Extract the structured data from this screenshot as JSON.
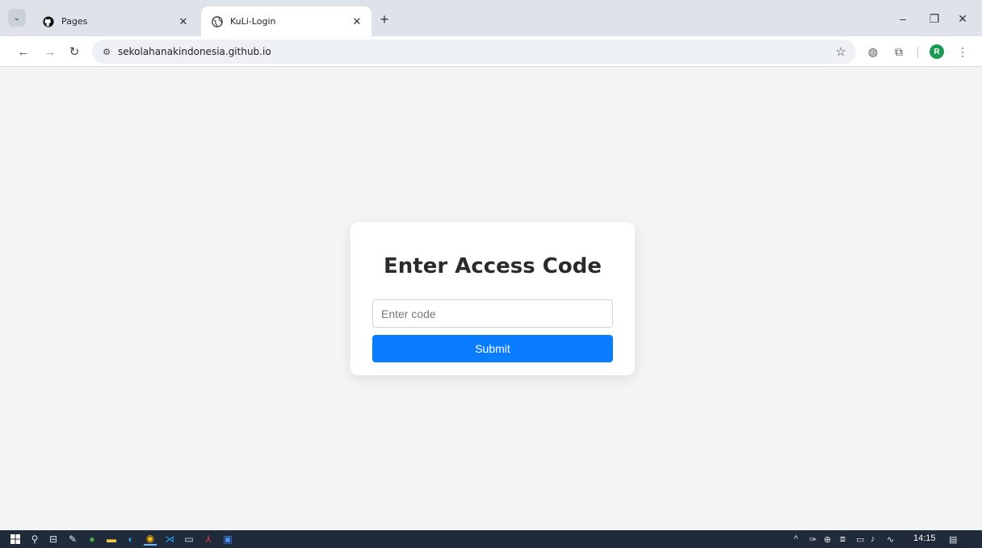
{
  "browser": {
    "tabs": [
      {
        "title": "Pages",
        "favicon": "github-icon",
        "active": false
      },
      {
        "title": "KuLi-Login",
        "favicon": "globe-icon",
        "active": true
      }
    ],
    "url": "sekolahanakindonesia.github.io",
    "profile_initial": "R",
    "accent": "#1a9a55"
  },
  "login": {
    "heading": "Enter Access Code",
    "input_placeholder": "Enter code",
    "input_value": "",
    "submit_label": "Submit",
    "button_color": "#0a7cff"
  },
  "taskbar": {
    "time": "14:15"
  }
}
